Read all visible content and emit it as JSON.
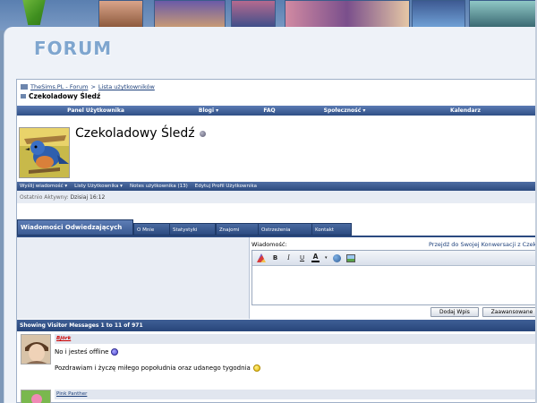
{
  "header": {
    "forum_title": "FORUM"
  },
  "breadcrumb": {
    "link1": "TheSims.PL - Forum",
    "separator": ">",
    "link2": "Lista użytkowników",
    "current": "Czekoladowy Śledź"
  },
  "navbar": {
    "items": [
      "Panel Użytkownika",
      "Blogi ▾",
      "FAQ",
      "Społeczność ▾",
      "Kalendarz"
    ]
  },
  "profile": {
    "username": "Czekoladowy Śledź",
    "actions": [
      "Wyślij wiadomość ▾",
      "Listy Użytkownika ▾",
      "Notes użytkownika (13)",
      "Edytuj Profil Użytkownika"
    ],
    "last_active_label": "Ostatnio Aktywny:",
    "last_active_value": "Dzisiaj 16:12"
  },
  "tabs": [
    "Wiadomości Odwiedzających",
    "O Mnie",
    "Statystyki",
    "Znajomi",
    "Ostrzeżenia",
    "Kontakt"
  ],
  "message_form": {
    "label": "Wiadomość:",
    "conversation_link": "Przejdź do Swojej Konwersacji z Czeko",
    "toolbar": {
      "bold": "B",
      "italic": "I",
      "underline": "U",
      "font_color": "A"
    },
    "submit_button": "Dodaj Wpis",
    "advanced_button": "Zaawansowane"
  },
  "visitor_messages": {
    "header": "Showing Visitor Messages 1 to 11 of 971",
    "messages": [
      {
        "author": "Björk",
        "line1": "No i jesteś offline",
        "line2": "Pozdrawiam i życzę miłego popołudnia oraz udanego tygodnia"
      },
      {
        "author": "Pink Panther"
      }
    ]
  },
  "colors": {
    "nav_blue": "#2f4f86",
    "accent_red": "#cc0000",
    "link_blue": "#1c3f7a"
  }
}
